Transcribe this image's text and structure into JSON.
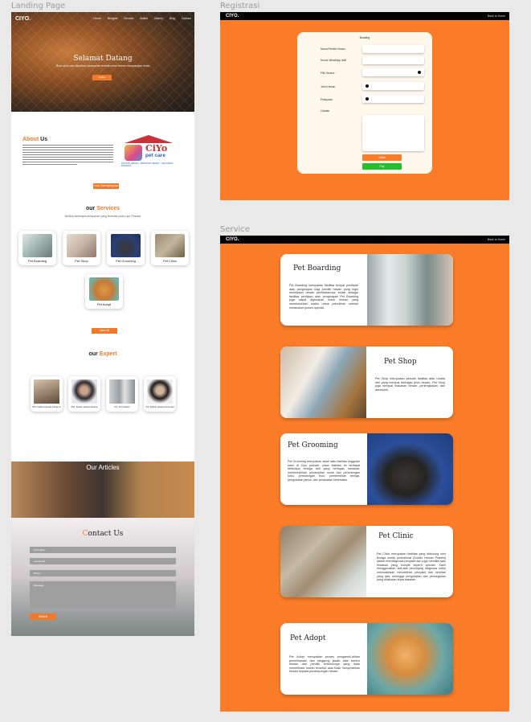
{
  "labels": {
    "landing": "Landing Page",
    "registrasi": "Registrasi",
    "service": "Service"
  },
  "landing": {
    "logo": "CIYO.",
    "nav": [
      "Home",
      "Bengkel",
      "Service",
      "Artikel",
      "Gallery",
      "Blog",
      "Contact"
    ],
    "hero_title": "Selamat Datang",
    "hero_subtitle": "Buat akun dan dapatkan pelayanan terbaik untuk hewan kesayangan Anda",
    "hero_button": "Daftar",
    "about_title_a": "About",
    "about_title_b": "Us",
    "logo_brand": "CiYo",
    "logo_petcare": "pet care",
    "logo_sub": "DOCTOR HEWAN · PENITIPAN HEWAN · GROOMING · PETSHOP",
    "about_button": "Lihat Selengkapnya",
    "services_title_a": "our",
    "services_title_b": "Services",
    "services_subtitle": "Berikut beberapa pelayanan yang tersedia pada ciyo Petcare",
    "services": [
      "Pet Boarding",
      "Pet Shop",
      "Pet Grooming",
      "Pet Clinic",
      "Pet Adopt"
    ],
    "services_button": "View All",
    "expert_title_a": "our",
    "expert_title_b": "Expert",
    "experts": [
      "Drh. Dokter Hewan Pertama",
      "Drh. Dokter Hewan Kedua",
      "Drs. Drh Dokter",
      "drh. Dokter Hewan Keempat"
    ],
    "articles_title": "Our Articles",
    "contact_title_a": "C",
    "contact_title_b": "ontact Us",
    "contact_fields": [
      "First Name",
      "Last Email",
      "Phone",
      "Message"
    ],
    "submit": "Submit"
  },
  "registrasi": {
    "logo": "CIYO.",
    "back": "Back to Home",
    "form_title": "Booking",
    "labels": [
      "Nama Pemilik Hewan",
      "Nomor WhatsApp Aktif",
      "Pilih Service",
      "Jenis Hewan",
      "Pelayanan",
      "Catatan"
    ],
    "cancel": "Batal",
    "pay": "Pay"
  },
  "service": {
    "logo": "CIYO.",
    "back": "Back to Home",
    "items": [
      {
        "title": "Pet Boarding",
        "desc": "Pet Boarding merupakan fasilitas tempat penitipan atau penginapan bagi pemilik hewan yang ingin menitipkan hewan peliharaannya, selain sebagai fasilitas penitipan atau penginapan Pet Boarding juga dapat digunakan untuk hewan yang membutuhkan waktu untuk pemulihan setelah melakukan proses operasi."
      },
      {
        "title": "Pet Shop",
        "desc": "Pet Shop merupakan sebuah fasilitas atau Usaha ritel yang menjual berbagai jenis hewan, Pet Shop juga menjual makanan hewan, perlengkapan, dan aksesoris."
      },
      {
        "title": "Pet Grooming",
        "desc": "Pet Grooming merupakan salah satu fasilitas unggulan kami di Ciyo petcare, pada fasilitas ini terdapat beberapa tenaga ahli yang bertugas merawat, membersihkan penampilan mulai dari pemotongan kuku, pemotongan bulu, pembersihan telinga, pengobatan jamur, dan perawatan kesehatan."
      },
      {
        "title": "Pet Clinic",
        "desc": "Pet Clinic merupakan fasilitas yang didukung oleh tenaga medis profesional (Dokter Hewan Praktisi) dalam mendiagnosa penyakit dan juga memiliki satu tindakan yang komplit seperti operasi. Kami menggunakan alat-alat penunjang diagnosa untuk memudahkan mendeteksi penyakit dan keluhan yang ada, sehingga pengobatan dan pencegahan yang dilakukan tepat sasaran."
      },
      {
        "title": "Pet Adopt",
        "desc": "Pet Adopt merupakan proses pengambil-alihan pemeliharaan dan tanggung jawab atas seekor hewan dari pemilik sebelumnya yang tidak memelihara hewan tersebut atau tidak menyerahkan hewan kepada penampungan hewan."
      }
    ]
  },
  "colors": {
    "accent": "#fb7d29",
    "green": "#22c02a",
    "black": "#000000"
  },
  "icons": [
    "chevron-down-icon",
    "radio-icon"
  ]
}
